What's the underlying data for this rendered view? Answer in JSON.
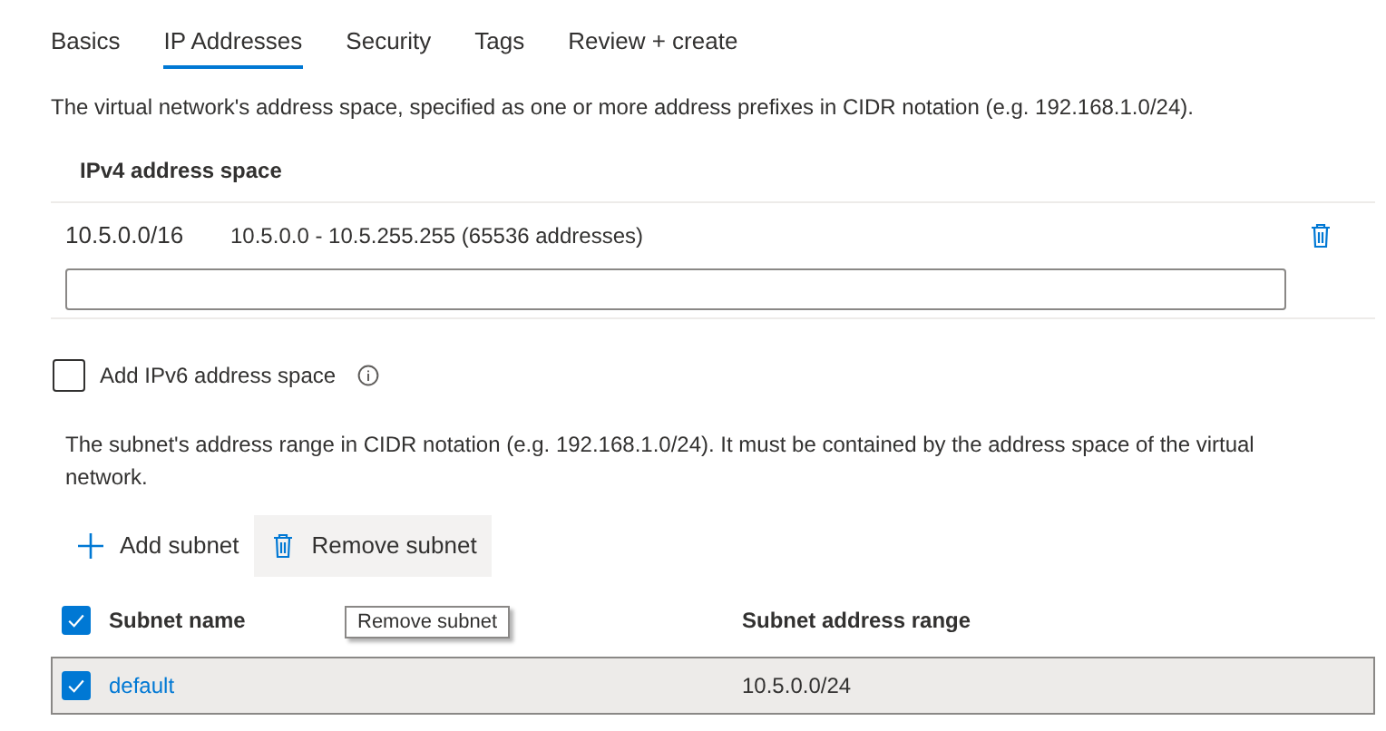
{
  "tabs": [
    {
      "label": "Basics",
      "selected": false
    },
    {
      "label": "IP Addresses",
      "selected": true
    },
    {
      "label": "Security",
      "selected": false
    },
    {
      "label": "Tags",
      "selected": false
    },
    {
      "label": "Review + create",
      "selected": false
    }
  ],
  "address_space_description": "The virtual network's address space, specified as one or more address prefixes in CIDR notation (e.g. 192.168.1.0/24).",
  "ipv4_table": {
    "header": "IPv4 address space",
    "rows": [
      {
        "prefix": "10.5.0.0/16",
        "range": "10.5.0.0 - 10.5.255.255 (65536 addresses)"
      }
    ]
  },
  "ipv6_option": {
    "label": "Add IPv6 address space",
    "checked": false
  },
  "subnet_description": "The subnet's address range in CIDR notation (e.g. 192.168.1.0/24). It must be contained by the address space of the virtual network.",
  "toolbar": [
    {
      "label": "Add subnet",
      "kind": "add",
      "hovered": false
    },
    {
      "label": "Remove subnet",
      "kind": "remove",
      "hovered": true
    }
  ],
  "tooltip": "Remove subnet",
  "subnet_table": {
    "select_all": true,
    "columns": [
      "Subnet name",
      "Subnet address range"
    ],
    "rows": [
      {
        "name": "default",
        "range": "10.5.0.0/24",
        "selected": true
      }
    ]
  }
}
